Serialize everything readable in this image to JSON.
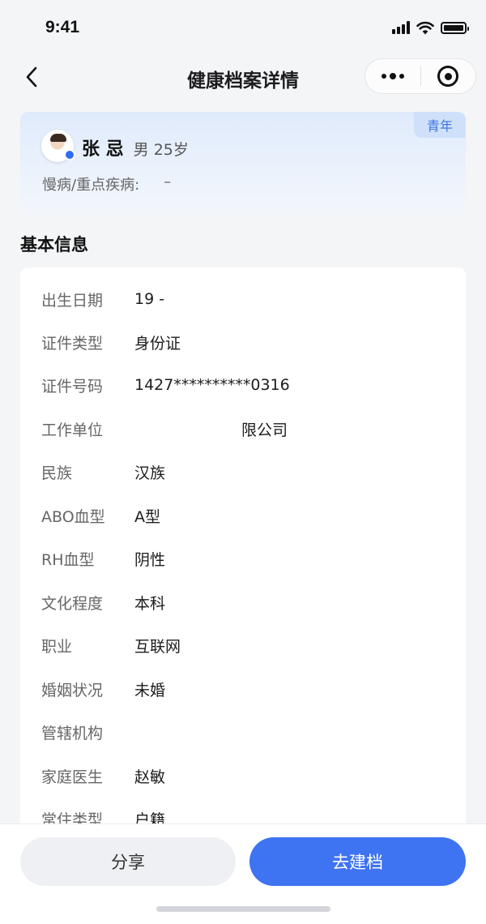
{
  "status_bar": {
    "time": "9:41"
  },
  "nav": {
    "title": "健康档案详情"
  },
  "profile": {
    "age_group_tag": "青年",
    "name": "张 忌",
    "gender_age": "男 25岁",
    "disease_label": "慢病/重点疾病:",
    "disease_value": "–"
  },
  "basic_info": {
    "title": "基本信息",
    "rows": [
      {
        "label": "出生日期",
        "value": "19 -"
      },
      {
        "label": "证件类型",
        "value": "身份证"
      },
      {
        "label": "证件号码",
        "value": "1427**********0316"
      },
      {
        "label": "工作单位",
        "value": "限公司"
      },
      {
        "label": "民族",
        "value": "汉族"
      },
      {
        "label": "ABO血型",
        "value": "A型"
      },
      {
        "label": "RH血型",
        "value": "阴性"
      },
      {
        "label": "文化程度",
        "value": "本科"
      },
      {
        "label": "职业",
        "value": "互联网"
      },
      {
        "label": "婚姻状况",
        "value": "未婚"
      },
      {
        "label": "管辖机构",
        "value": ""
      },
      {
        "label": "家庭医生",
        "value": "赵敏"
      },
      {
        "label": "常住类型",
        "value": "户籍"
      }
    ]
  },
  "actions": {
    "share_label": "分享",
    "create_label": "去建档"
  },
  "colors": {
    "accent": "#3e73f1",
    "tag_text": "#3b73e6",
    "page_bg": "#f4f5f7"
  }
}
